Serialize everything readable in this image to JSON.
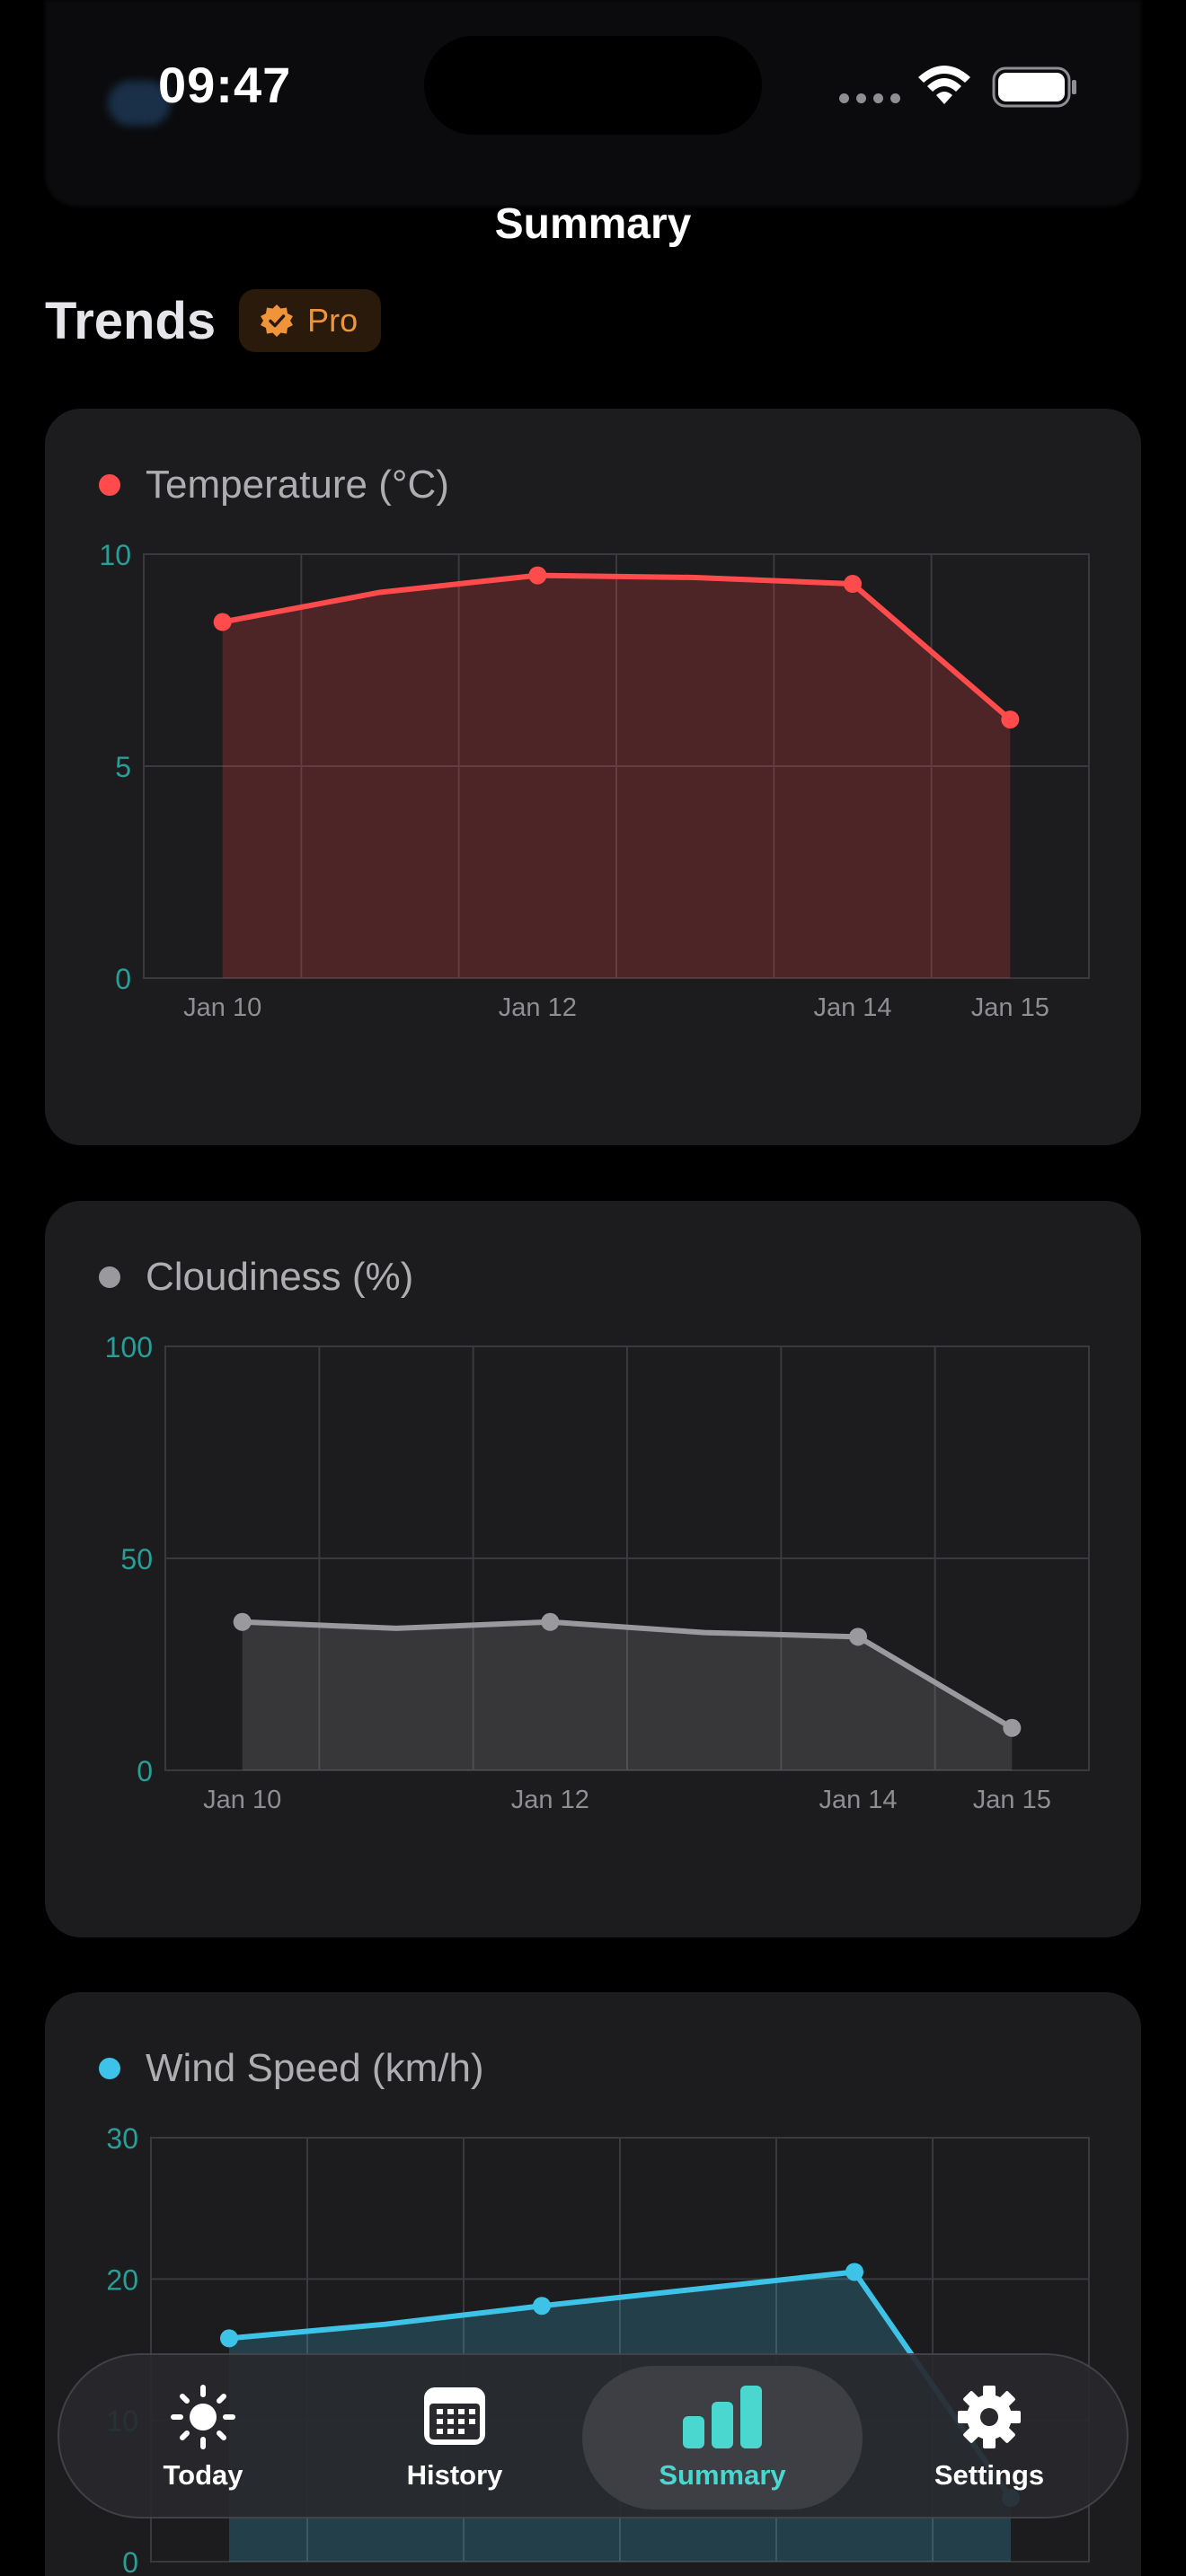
{
  "status_bar": {
    "time": "09:47"
  },
  "nav": {
    "title": "Summary"
  },
  "section": {
    "title": "Trends",
    "badge": "Pro"
  },
  "colors": {
    "temperature": "#ff4b4b",
    "cloudiness": "#9a9a9e",
    "wind": "#3ec3e8",
    "accent": "#4ad7cf",
    "pro": "#f0943a"
  },
  "charts": [
    {
      "title": "Temperature (°C)",
      "dot_color": "#ff4b4b"
    },
    {
      "title": "Cloudiness (%)",
      "dot_color": "#9a9a9e"
    },
    {
      "title": "Wind Speed (km/h)",
      "dot_color": "#3ec3e8"
    }
  ],
  "chart_data": [
    {
      "type": "area",
      "title": "Temperature (°C)",
      "color": "#ff4b4b",
      "x": [
        10,
        11,
        12,
        13,
        14,
        15
      ],
      "y": [
        8.4,
        9.1,
        9.5,
        9.45,
        9.3,
        6.1
      ],
      "marked_x": [
        10,
        12,
        14,
        15
      ],
      "x_tick_labels": [
        {
          "x": 10,
          "label": "Jan 10"
        },
        {
          "x": 12,
          "label": "Jan 12"
        },
        {
          "x": 14,
          "label": "Jan 14"
        },
        {
          "x": 15,
          "label": "Jan 15"
        }
      ],
      "y_ticks": [
        0,
        5,
        10
      ],
      "ylim": [
        0,
        10
      ],
      "xlim": [
        9.5,
        15.5
      ],
      "grid": true
    },
    {
      "type": "area",
      "title": "Cloudiness (%)",
      "color": "#9a9a9e",
      "x": [
        10,
        11,
        12,
        13,
        14,
        15
      ],
      "y": [
        35,
        33.5,
        35,
        32.5,
        31.5,
        10
      ],
      "marked_x": [
        10,
        12,
        14,
        15
      ],
      "x_tick_labels": [
        {
          "x": 10,
          "label": "Jan 10"
        },
        {
          "x": 12,
          "label": "Jan 12"
        },
        {
          "x": 14,
          "label": "Jan 14"
        },
        {
          "x": 15,
          "label": "Jan 15"
        }
      ],
      "y_ticks": [
        0,
        50,
        100
      ],
      "ylim": [
        0,
        100
      ],
      "xlim": [
        9.5,
        15.5
      ],
      "grid": true
    },
    {
      "type": "area",
      "title": "Wind Speed (km/h)",
      "color": "#3ec3e8",
      "x": [
        10,
        11,
        12,
        13,
        14,
        15
      ],
      "y": [
        15.8,
        16.8,
        18.1,
        19.3,
        20.5,
        4.5
      ],
      "marked_x": [
        10,
        12,
        14,
        15
      ],
      "x_tick_labels": [],
      "y_ticks": [
        0,
        10,
        20,
        30
      ],
      "ylim": [
        0,
        30
      ],
      "xlim": [
        9.5,
        15.5
      ],
      "grid": true
    }
  ],
  "tabs": [
    {
      "label": "Today",
      "icon": "sun-icon"
    },
    {
      "label": "History",
      "icon": "calendar-icon"
    },
    {
      "label": "Summary",
      "icon": "bar-chart-icon",
      "active": true
    },
    {
      "label": "Settings",
      "icon": "gear-icon"
    }
  ]
}
